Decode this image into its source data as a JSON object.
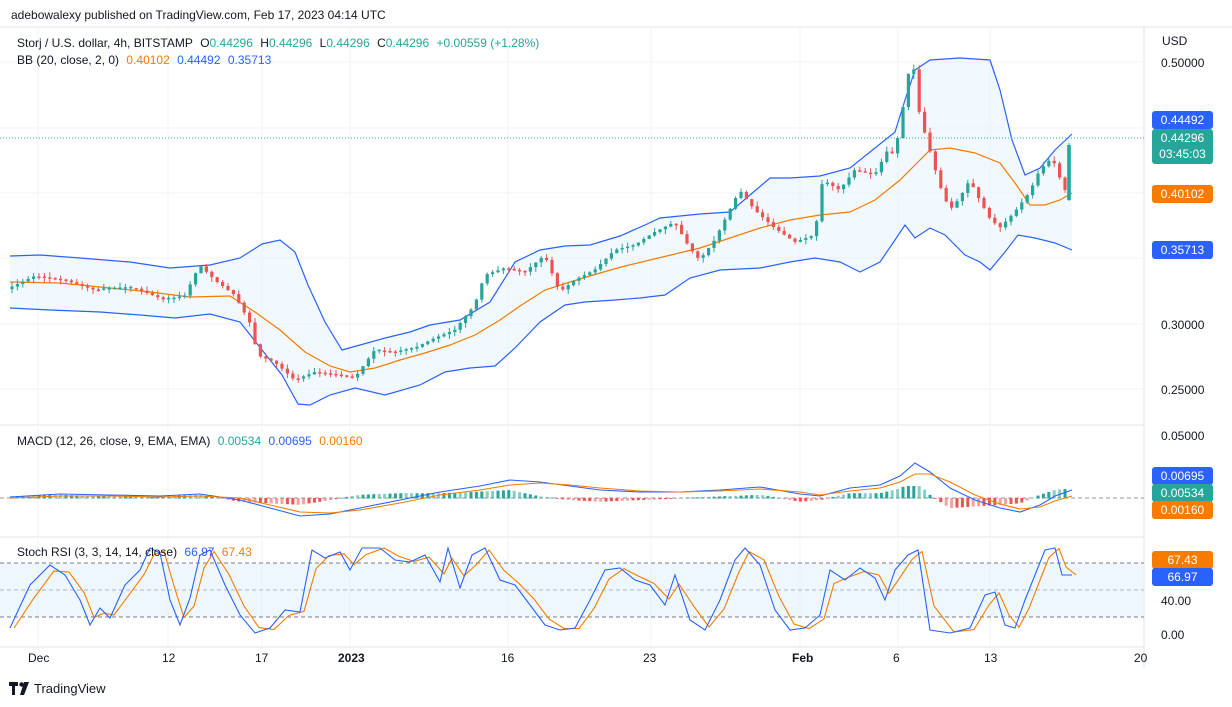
{
  "header": {
    "published_text": "adebowalexy published on TradingView.com, Feb 17, 2023 04:14 UTC"
  },
  "symbol_legend": {
    "title": "Storj / U.S. dollar, 4h, BITSTAMP",
    "o_label": "O",
    "o": "0.44296",
    "h_label": "H",
    "h": "0.44296",
    "l_label": "L",
    "l": "0.44296",
    "c_label": "C",
    "c": "0.44296",
    "change": "+0.00559 (+1.28%)"
  },
  "bb_legend": {
    "label": "BB (20, close, 2, 0)",
    "basis": "0.40102",
    "upper": "0.44492",
    "lower": "0.35713"
  },
  "macd_legend": {
    "label": "MACD (12, 26, close, 9, EMA, EMA)",
    "hist": "0.00534",
    "macd": "0.00695",
    "signal": "0.00160"
  },
  "stoch_legend": {
    "label": "Stoch RSI (3, 3, 14, 14, close)",
    "k": "66.97",
    "d": "67.43"
  },
  "price_axis": {
    "currency": "USD",
    "ticks": [
      "0.50000",
      "0.30000",
      "0.25000"
    ],
    "tags": {
      "upper_band": "0.44492",
      "last_price": "0.44296",
      "countdown": "03:45:03",
      "basis": "0.40102",
      "lower_band": "0.35713"
    }
  },
  "macd_axis": {
    "ticks": [
      "0.05000"
    ],
    "tags": {
      "macd": "0.00695",
      "hist": "0.00534",
      "signal": "0.00160"
    }
  },
  "stoch_axis": {
    "ticks": [
      "40.00",
      "0.00"
    ],
    "tags": {
      "d": "67.43",
      "k": "66.97"
    }
  },
  "time_axis": [
    "Dec",
    "12",
    "17",
    "2023",
    "16",
    "23",
    "Feb",
    "6",
    "13",
    "20"
  ],
  "footer": {
    "brand": "TradingView"
  },
  "colors": {
    "up": "#26a69a",
    "down": "#ef5350",
    "band": "#2962ff",
    "basis": "#f57c00",
    "band_fill": "#e3f2fd",
    "macd_line": "#2962ff",
    "signal_line": "#f57c00"
  }
}
